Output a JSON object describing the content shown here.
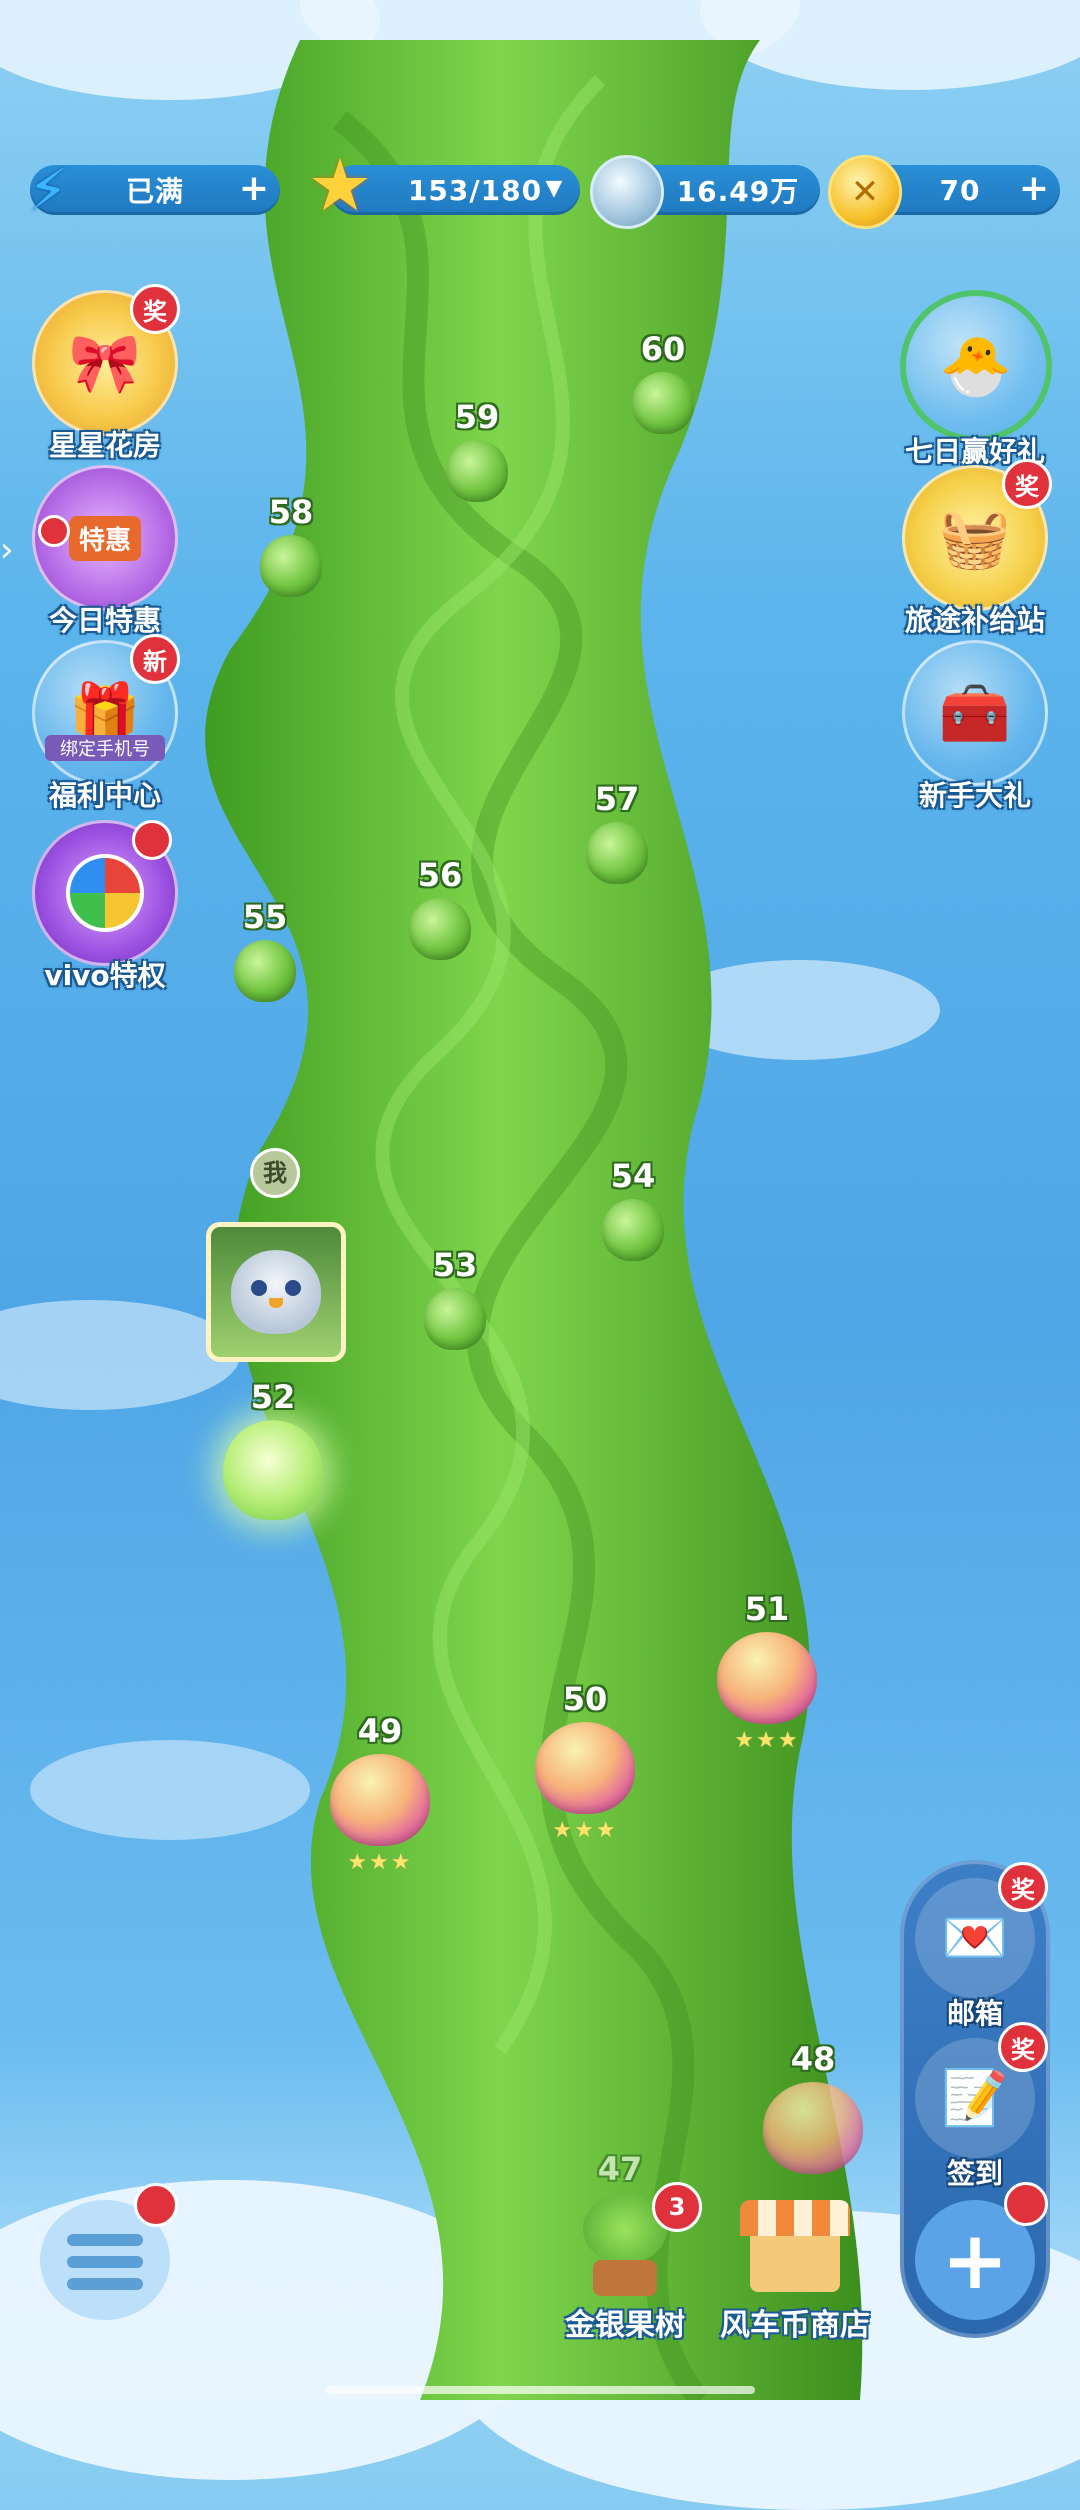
{
  "resources": {
    "energy": {
      "value": "已满",
      "icon": "lightning-icon"
    },
    "stars": {
      "value": "153/180",
      "icon": "star-icon"
    },
    "silver": {
      "value": "16.49万",
      "icon": "silver-coin-icon"
    },
    "gold": {
      "value": "70",
      "icon": "gold-coin-icon"
    }
  },
  "left_menu": [
    {
      "label": "星星花房",
      "badge": "奖",
      "icon": "flower-gift-icon"
    },
    {
      "label": "今日特惠",
      "badge": "",
      "inner": "特惠",
      "icon": "shop-icon"
    },
    {
      "label": "福利中心",
      "badge": "新",
      "inner": "绑定手机号",
      "icon": "gift-box-icon"
    },
    {
      "label": "vivo特权",
      "badge": "",
      "icon": "vivo-icon"
    }
  ],
  "right_menu": [
    {
      "label": "七日赢好礼",
      "badge": "",
      "icon": "chick-egg-icon"
    },
    {
      "label": "旅途补给站",
      "badge": "奖",
      "icon": "supply-basket-icon"
    },
    {
      "label": "新手大礼",
      "badge": "",
      "icon": "treasure-chest-icon"
    }
  ],
  "levels": [
    {
      "num": "47"
    },
    {
      "num": "48"
    },
    {
      "num": "49",
      "stars": 3
    },
    {
      "num": "50",
      "stars": 3
    },
    {
      "num": "51",
      "stars": 3
    },
    {
      "num": "52",
      "current": true
    },
    {
      "num": "53"
    },
    {
      "num": "54"
    },
    {
      "num": "55"
    },
    {
      "num": "56"
    },
    {
      "num": "57"
    },
    {
      "num": "58"
    },
    {
      "num": "59"
    },
    {
      "num": "60"
    }
  ],
  "player": {
    "tag": "我",
    "avatar": "bird-avatar-icon"
  },
  "bottom": {
    "tree": {
      "label": "金银果树",
      "badge": "3"
    },
    "shop": {
      "label": "风车币商店"
    }
  },
  "right_panel": {
    "mail": {
      "label": "邮箱",
      "badge": "奖"
    },
    "signin": {
      "label": "签到",
      "badge": "奖"
    }
  },
  "colors": {
    "badge": "#e0323c",
    "vine": "#5cc437",
    "sky": "#5cb5ec"
  }
}
